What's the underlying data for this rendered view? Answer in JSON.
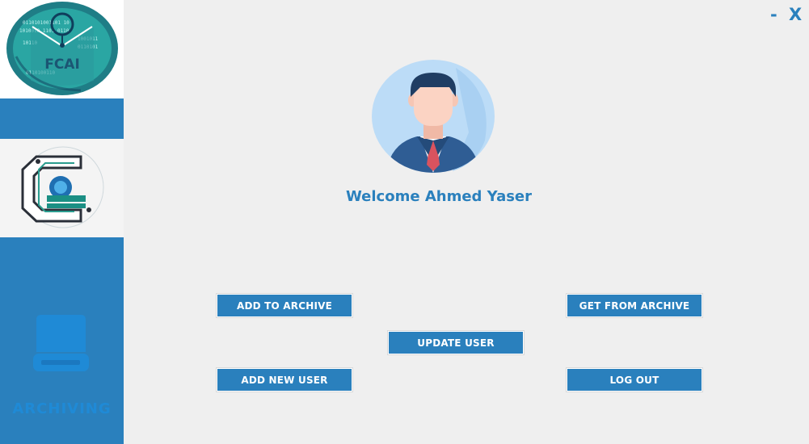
{
  "window": {
    "minimize_label": "-",
    "close_label": "X"
  },
  "sidebar": {
    "logo_top_text": "FCAI",
    "archive_label": "ARCHIVING"
  },
  "main": {
    "welcome_text": "Welcome Ahmed Yaser",
    "buttons": {
      "add_to_archive": "ADD TO ARCHIVE",
      "get_from_archive": "GET FROM ARCHIVE",
      "update_user": "UPDATE USER",
      "add_new_user": "ADD NEW USER",
      "log_out": "LOG OUT"
    }
  },
  "colors": {
    "accent": "#2a80bd",
    "background": "#efefef",
    "archive_label": "#1f8ad6",
    "logo_teal": "#2aa6a3"
  },
  "icons": [
    "fcai-logo",
    "faculty-logo",
    "archive-drive-icon",
    "user-avatar-icon"
  ]
}
